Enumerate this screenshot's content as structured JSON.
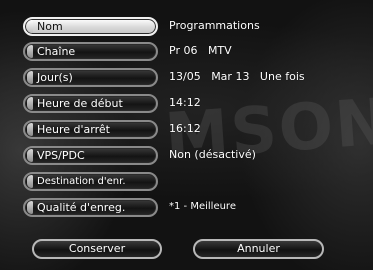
{
  "menu": {
    "items": [
      {
        "label": "Nom",
        "value": "Programmations",
        "active": true
      },
      {
        "label": "Chaîne",
        "value": "Pr 06   MTV",
        "active": false
      },
      {
        "label": "Jour(s)",
        "value": "13/05   Mar 13   Une fois",
        "active": false
      },
      {
        "label": "Heure de début",
        "value": "14:12",
        "active": false
      },
      {
        "label": "Heure d'arrêt",
        "value": "16:12",
        "active": false
      },
      {
        "label": "VPS/PDC",
        "value": "Non (désactivé)",
        "active": false
      },
      {
        "label": "Destination d'enr.",
        "value": "",
        "active": false
      },
      {
        "label": "Qualité d'enreg.",
        "value": "*1 - Meilleure",
        "active": false
      }
    ]
  },
  "actions": {
    "save_label": "Conserver",
    "cancel_label": "Annuler"
  },
  "background": {
    "watermark": "MSON"
  },
  "colors": {
    "active_item": "#e6e6e6",
    "button_border": "#8a8a8a",
    "text": "#ffffff",
    "background": "#121212"
  }
}
